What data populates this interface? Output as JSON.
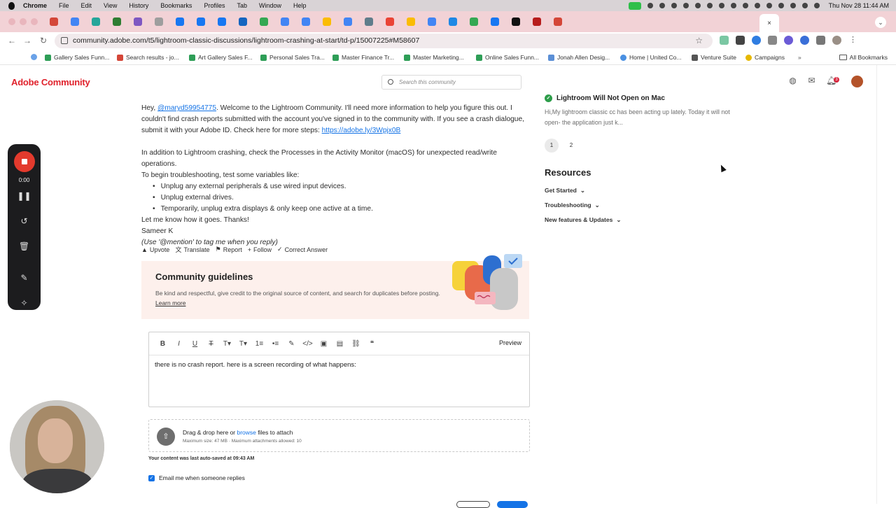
{
  "macos_menubar": {
    "app": "Chrome",
    "menus": [
      "File",
      "Edit",
      "View",
      "History",
      "Bookmarks",
      "Profiles",
      "Tab",
      "Window",
      "Help"
    ],
    "clock": "Thu Nov 28  11:44 AM"
  },
  "browser": {
    "url": "community.adobe.com/t5/lightroom-classic-discussions/lightroom-crashing-at-start/td-p/15007225#M58607",
    "active_tab_close": "×",
    "bookmarks": [
      "Gallery Sales Funn...",
      "Search results - jo...",
      "Art Gallery Sales F...",
      "Personal Sales Tra...",
      "Master Finance Tr...",
      "Master Marketing...",
      "Online Sales Funn...",
      "Jonah Allen Desig...",
      "Home | United Co...",
      "Venture Suite",
      "Campaigns"
    ],
    "all_bookmarks": "All Bookmarks"
  },
  "site": {
    "logo": "Adobe Community",
    "search_placeholder": "Search this community",
    "notification_count": "3"
  },
  "post": {
    "greeting_pre": "Hey, ",
    "mention": "@maryd59954775",
    "greeting_post": ". Welcome to the Lightroom Community. I'll need more information to help you figure this out. I couldn't find crash reports submitted with the account you've signed in to the community with. If you see a crash dialogue, submit it with your Adobe ID. Check here for more steps: ",
    "link": "https://adobe.ly/3Wpjx0B",
    "para2_line1": "In addition to Lightroom crashing, check the Processes in the Activity Monitor (macOS) for unexpected read/write operations.",
    "para2_line2": "To begin troubleshooting, test some variables like:",
    "bullets": [
      "Unplug any external peripherals & use wired input devices.",
      "Unplug external drives.",
      "Temporarily, unplug extra displays & only keep one active at a time."
    ],
    "closing": "Let me know how it goes. Thanks!",
    "author": "Sameer K",
    "note": "(Use '@mention' to tag me when you reply)"
  },
  "actions": {
    "upvote": "Upvote",
    "translate": "Translate",
    "report": "Report",
    "follow": "Follow",
    "correct": "Correct Answer"
  },
  "guidelines": {
    "title": "Community guidelines",
    "desc": "Be kind and respectful, give credit to the original source of content, and search for duplicates before posting.",
    "more": "Learn more"
  },
  "editor": {
    "preview": "Preview",
    "content": "there is no crash report. here is a screen recording of what happens:",
    "toolbar": [
      "B",
      "I",
      "U",
      "T",
      "T▾",
      "T▾",
      "1≡",
      "•≡",
      "✎",
      "</>",
      "▣",
      "▤",
      "⛓",
      "❝"
    ]
  },
  "attach": {
    "pre": "Drag & drop here or ",
    "browse": "browse",
    "post": " files to attach",
    "limits": "Maximum size: 47 MB · Maximum attachments allowed: 10"
  },
  "autosave": "Your content was last auto-saved at 09:43 AM",
  "email_label": "Email me when someone replies",
  "sidebar": {
    "related_title": "Lightroom Will Not Open on Mac",
    "related_excerpt": "Hi,My lightroom classic cc has been acting up lately. Today it will not open- the application just k...",
    "pages": [
      "1",
      "2"
    ],
    "resources_title": "Resources",
    "resources": [
      "Get Started",
      "Troubleshooting",
      "New features & Updates"
    ]
  },
  "recorder": {
    "time": "0:00"
  }
}
